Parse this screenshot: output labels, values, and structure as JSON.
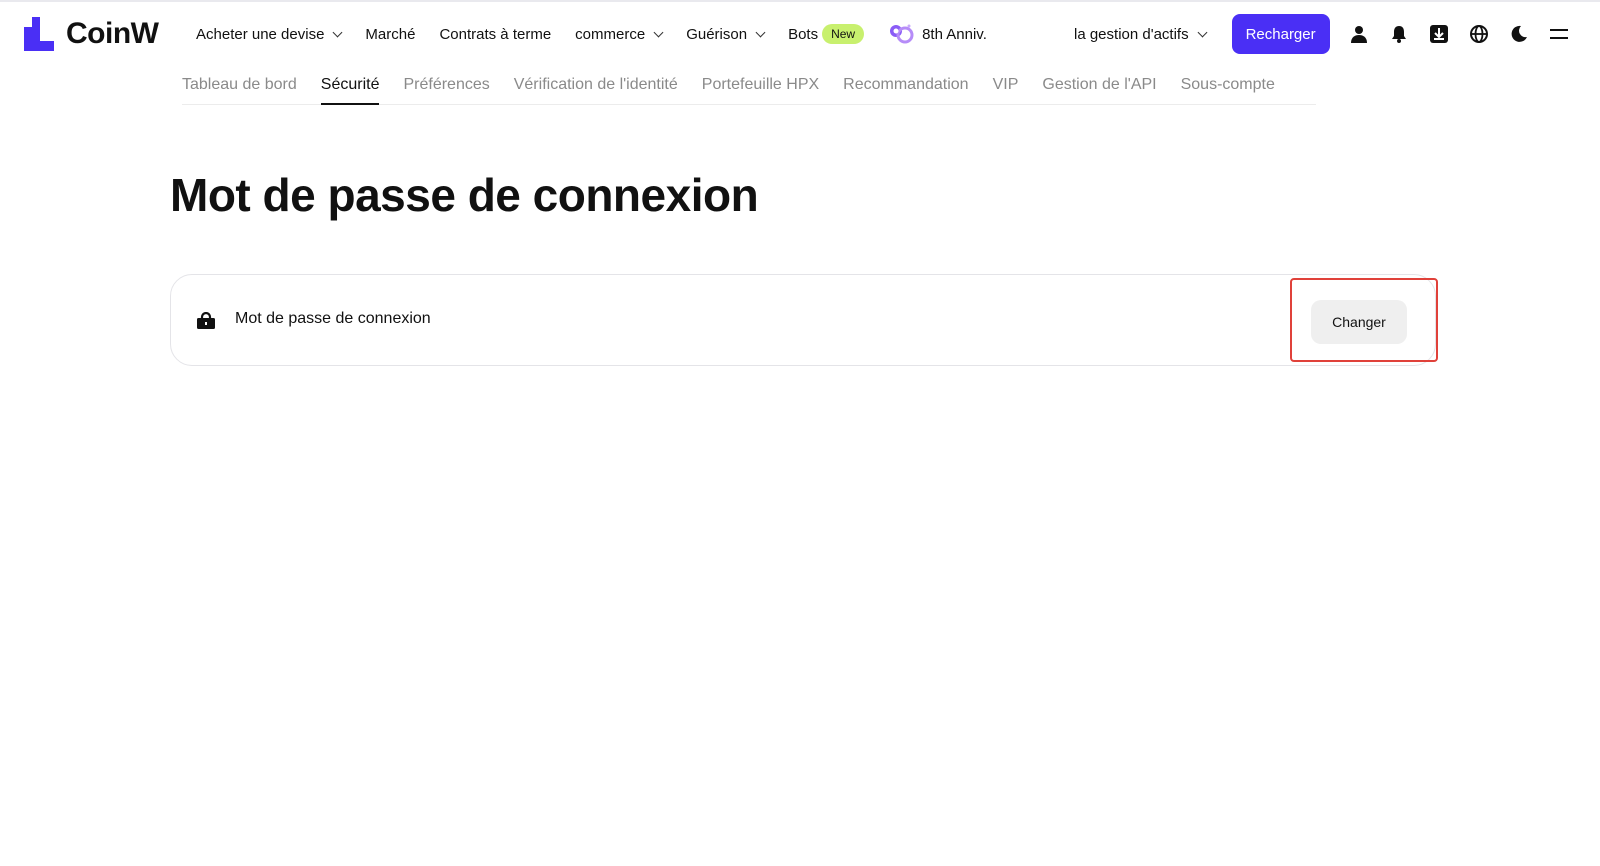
{
  "brand": {
    "name": "CoinW",
    "color": "#4a2ff5"
  },
  "nav": {
    "items": [
      {
        "label": "Acheter une devise",
        "dropdown": true
      },
      {
        "label": "Marché",
        "dropdown": false
      },
      {
        "label": "Contrats à terme",
        "dropdown": false
      },
      {
        "label": "commerce",
        "dropdown": true
      },
      {
        "label": "Guérison",
        "dropdown": true
      }
    ],
    "bots": {
      "label": "Bots",
      "badge": "New"
    },
    "anniversary": "8th Anniv."
  },
  "right_nav": {
    "asset_management": "la gestion d'actifs",
    "recharge_label": "Recharger",
    "icons": [
      "user-icon",
      "bell-icon",
      "download-icon",
      "globe-icon",
      "moon-icon",
      "menu-icon"
    ]
  },
  "tabs": [
    {
      "label": "Tableau de bord",
      "active": false
    },
    {
      "label": "Sécurité",
      "active": true
    },
    {
      "label": "Préférences",
      "active": false
    },
    {
      "label": "Vérification de l'identité",
      "active": false
    },
    {
      "label": "Portefeuille HPX",
      "active": false
    },
    {
      "label": "Recommandation",
      "active": false
    },
    {
      "label": "VIP",
      "active": false
    },
    {
      "label": "Gestion de l'API",
      "active": false
    },
    {
      "label": "Sous-compte",
      "active": false
    }
  ],
  "main": {
    "title": "Mot de passe de connexion",
    "card": {
      "icon": "lock-icon",
      "label": "Mot de passe de connexion",
      "button_label": "Changer"
    }
  },
  "colors": {
    "accent": "#4a2ff5",
    "badge": "#c8f06e",
    "highlight": "#e0413a"
  }
}
